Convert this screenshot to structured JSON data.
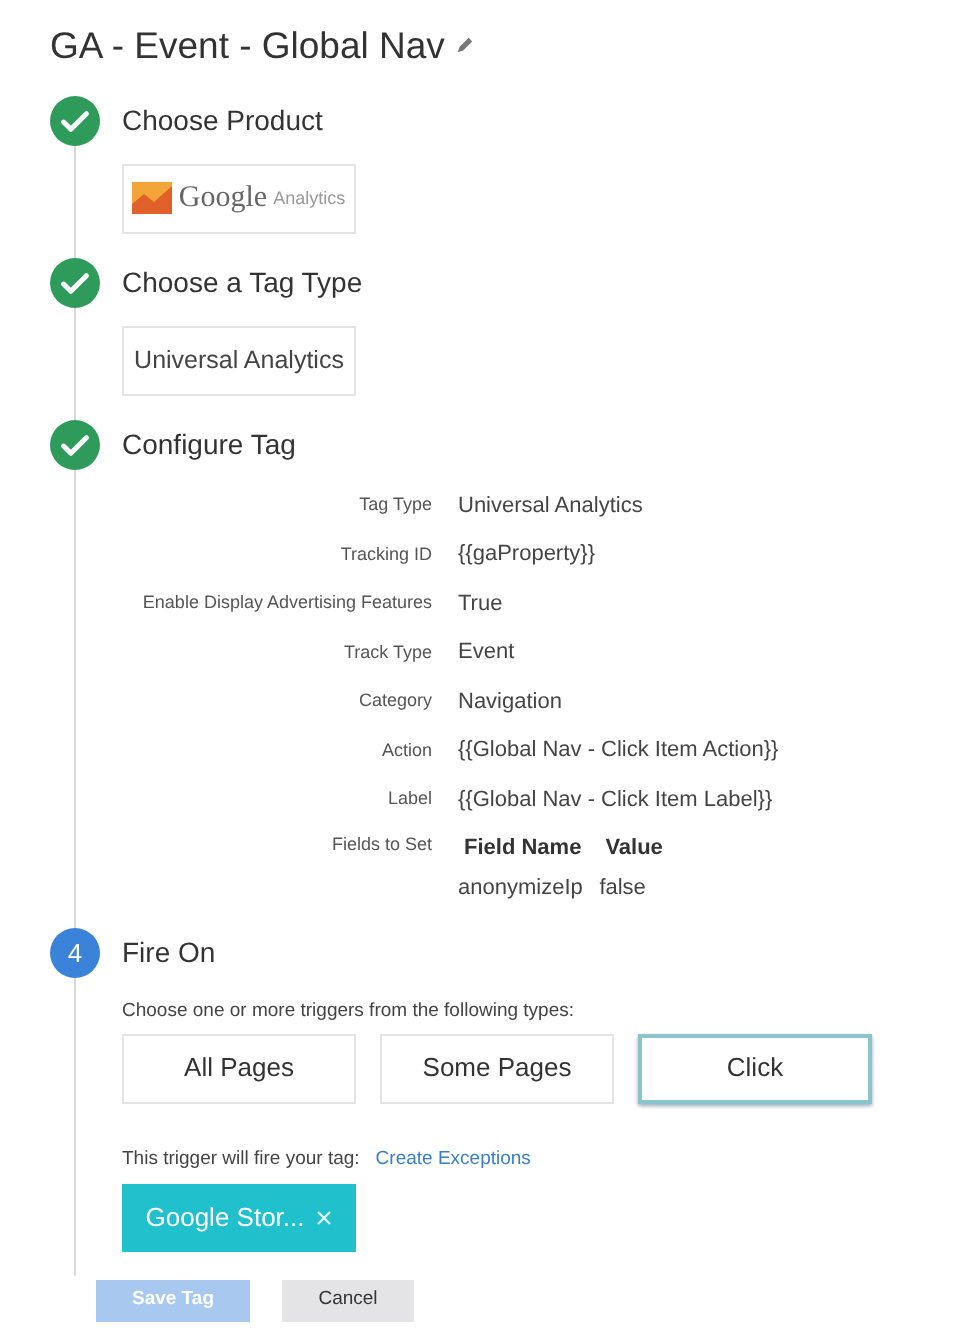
{
  "title": "GA - Event - Global Nav",
  "steps": [
    {
      "kind": "done",
      "title": "Choose Product",
      "product": {
        "brand": "Google",
        "name": "Analytics"
      }
    },
    {
      "kind": "done",
      "title": "Choose a Tag Type",
      "tag_type": "Universal Analytics"
    },
    {
      "kind": "done",
      "title": "Configure Tag",
      "fields": [
        {
          "label": "Tag Type",
          "value": "Universal Analytics"
        },
        {
          "label": "Tracking ID",
          "value": "{{gaProperty}}"
        },
        {
          "label": "Enable Display Advertising Features",
          "value": "True"
        },
        {
          "label": "Track Type",
          "value": "Event"
        },
        {
          "label": "Category",
          "value": "Navigation"
        },
        {
          "label": "Action",
          "value": "{{Global Nav - Click Item Action}}"
        },
        {
          "label": "Label",
          "value": "{{Global Nav - Click Item Label}}"
        }
      ],
      "fields_to_set": {
        "label": "Fields to Set",
        "columns": [
          "Field Name",
          "Value"
        ],
        "rows": [
          [
            "anonymizeIp",
            "false"
          ]
        ]
      }
    },
    {
      "kind": "number",
      "number": "4",
      "title": "Fire On",
      "prompt": "Choose one or more triggers from the following types:",
      "triggers": [
        {
          "label": "All Pages",
          "selected": false
        },
        {
          "label": "Some Pages",
          "selected": false
        },
        {
          "label": "Click",
          "selected": true
        }
      ],
      "fire_text": "This trigger will fire your tag:",
      "exceptions_link": "Create Exceptions",
      "chips": [
        {
          "label": "Google Stor..."
        }
      ]
    }
  ],
  "buttons": [
    {
      "label": "Save Tag",
      "kind": "primary",
      "disabled": true
    },
    {
      "label": "Cancel",
      "kind": "secondary",
      "disabled": false
    }
  ]
}
